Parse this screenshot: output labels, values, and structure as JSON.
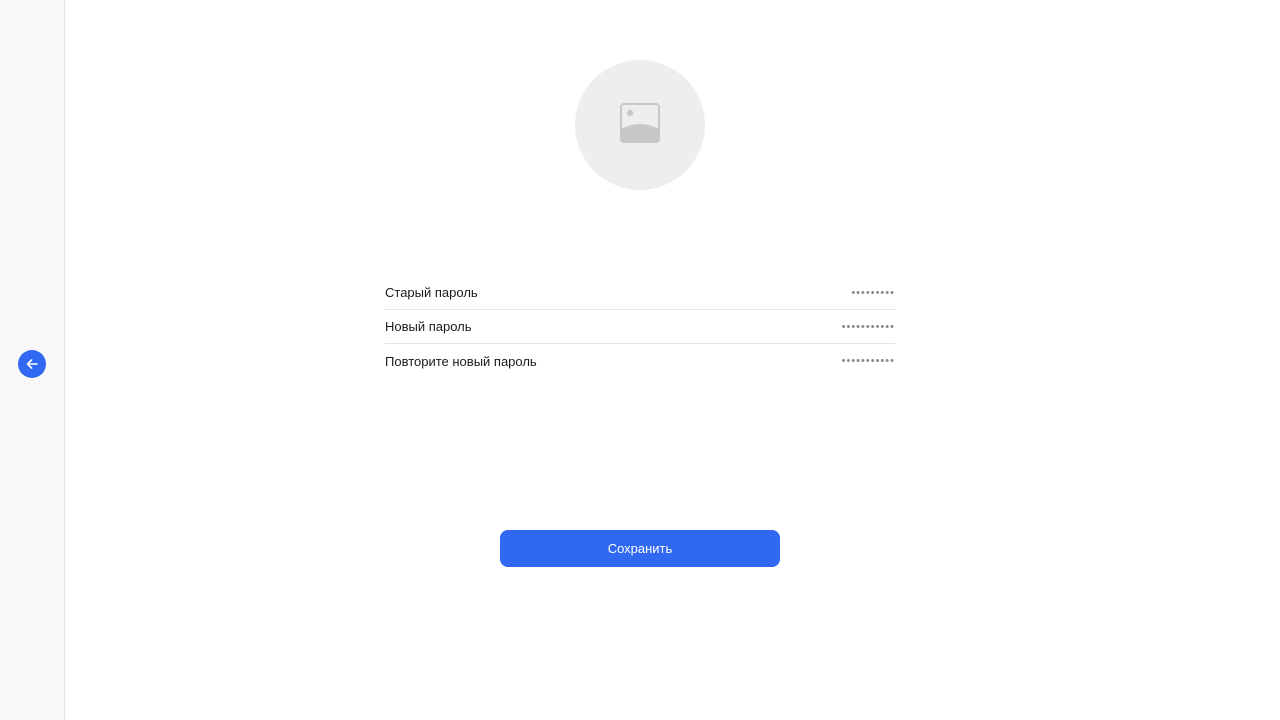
{
  "sidebar": {
    "back_icon": "arrow-left-icon"
  },
  "avatar": {
    "icon": "image-placeholder-icon"
  },
  "form": {
    "fields": [
      {
        "label": "Старый пароль",
        "value": "•••••••••"
      },
      {
        "label": "Новый пароль",
        "value": "•••••••••••"
      },
      {
        "label": "Повторите новый пароль",
        "value": "•••••••••••"
      }
    ]
  },
  "actions": {
    "save_label": "Сохранить"
  },
  "colors": {
    "accent": "#3068f1",
    "sidebar_bg": "#f9f9f9",
    "avatar_bg": "#eeeeee",
    "placeholder_icon": "#c8c8c8"
  }
}
